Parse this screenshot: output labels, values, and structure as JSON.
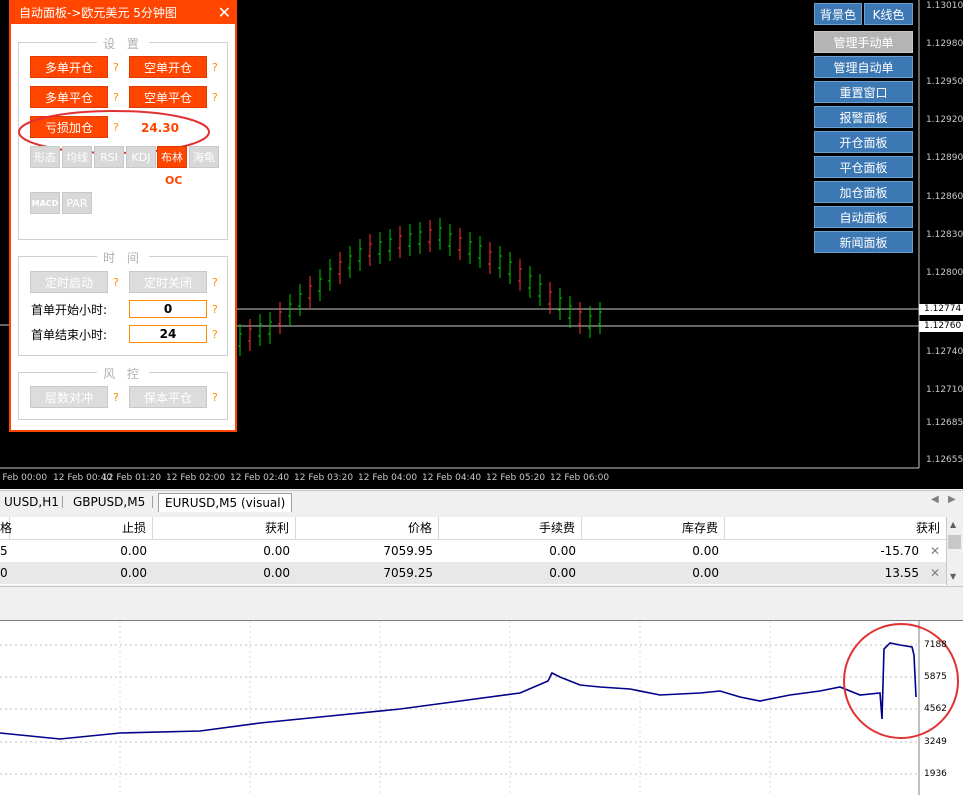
{
  "panel": {
    "title": "自动面板->欧元美元 5分钟图",
    "close": "✕",
    "settings_title": "设 置",
    "buttons": {
      "long_open": "多单开仓",
      "short_open": "空单开仓",
      "long_close": "多单平仓",
      "short_close": "空单平仓",
      "loss_add": "亏损加仓"
    },
    "loss_add_value": "24.30",
    "help": "?",
    "indicators": [
      "形态",
      "均线",
      "RSI",
      "KDJ",
      "布林",
      "海龟"
    ],
    "indicators_row2": [
      "MACD",
      "PAR"
    ],
    "indicator_note": "OC",
    "time_title": "时 间",
    "timer_start": "定时启动",
    "timer_stop": "定时关闭",
    "first_start_label": "首单开始小时:",
    "first_start_value": "0",
    "first_end_label": "首单结束小时:",
    "first_end_value": "24",
    "risk_title": "风 控",
    "layer_hedge": "层数对冲",
    "breakeven": "保本平仓"
  },
  "right_buttons": {
    "bg_color": "背景色",
    "k_color": "K线色",
    "items": [
      "管理手动单",
      "管理自动单",
      "重置窗口",
      "报警面板",
      "开仓面板",
      "平仓面板",
      "加仓面板",
      "自动面板",
      "新闻面板"
    ]
  },
  "price_axis": [
    "1.13010",
    "1.12980",
    "1.12950",
    "1.12920",
    "1.12890",
    "1.12860",
    "1.12830",
    "1.12800",
    "1.12740",
    "1.12710",
    "1.12685",
    "1.12655"
  ],
  "price_boxes": [
    "1.12774",
    "1.12760"
  ],
  "time_axis": [
    "12 Feb 00:00",
    "12 Feb 00:40",
    "12 Feb 01:20",
    "12 Feb 02:00",
    "12 Feb 02:40",
    "12 Feb 03:20",
    "12 Feb 04:00",
    "12 Feb 04:40",
    "12 Feb 05:20",
    "12 Feb 06:00"
  ],
  "tabs": [
    "UUSD,H1",
    "GBPUSD,M5",
    "EURUSD,M5 (visual)"
  ],
  "table": {
    "headers": [
      "格",
      "止损",
      "获利",
      "价格",
      "手续费",
      "库存费",
      "获利"
    ],
    "rows": [
      [
        "5",
        "0.00",
        "0.00",
        "7059.95",
        "0.00",
        "0.00",
        "-15.70"
      ],
      [
        "0",
        "0.00",
        "0.00",
        "7059.25",
        "0.00",
        "0.00",
        "13.55"
      ]
    ],
    "close": "✕"
  },
  "equity_axis": [
    "7188",
    "5875",
    "4562",
    "3249",
    "1936"
  ],
  "colors": {
    "accent": "#ff4500",
    "blue_button": "#3c78b4",
    "bull": "#00c800",
    "bear": "#ff3232",
    "equity": "#00008b"
  }
}
